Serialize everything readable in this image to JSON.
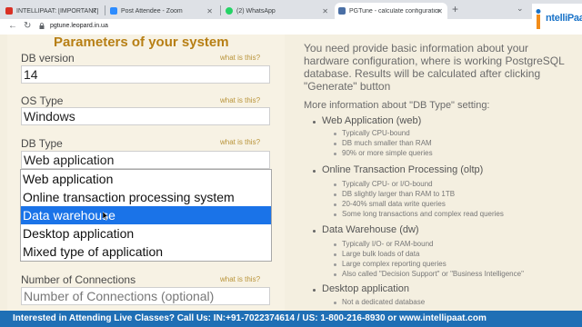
{
  "browser": {
    "tabs": [
      {
        "label": "INTELLIPAAT: [IMPORTANT] Post",
        "favicon_color": "#d93025"
      },
      {
        "label": "Post Attendee - Zoom",
        "favicon_color": "#2d8cff"
      },
      {
        "label": "(2) WhatsApp",
        "favicon_color": "#25d366"
      },
      {
        "label": "PGTune - calculate configuration",
        "favicon_color": "#4a6fa5"
      }
    ],
    "new_tab": "+",
    "url": "pgtune.leopard.in.ua"
  },
  "logo": {
    "text": "ntelliPaat"
  },
  "form": {
    "heading": "Parameters of your system",
    "hint": "what is this?",
    "db_version": {
      "label": "DB version",
      "value": "14"
    },
    "os_type": {
      "label": "OS Type",
      "value": "Windows"
    },
    "db_type": {
      "label": "DB Type",
      "value": "Web application",
      "options": [
        "Web application",
        "Online transaction processing system",
        "Data warehouse",
        "Desktop application",
        "Mixed type of application"
      ],
      "highlighted": "Data warehouse"
    },
    "connections": {
      "label": "Number of Connections",
      "placeholder": "Number of Connections (optional)"
    }
  },
  "info": {
    "intro": "You need provide basic information about your hardware configuration, where is working PostgreSQL database. Results will be calculated after clicking \"Generate\" button",
    "more": "More information about \"DB Type\" setting:",
    "categories": [
      {
        "name": "Web Application (web)",
        "bullets": [
          "Typically CPU-bound",
          "DB much smaller than RAM",
          "90% or more simple queries"
        ]
      },
      {
        "name": "Online Transaction Processing (oltp)",
        "bullets": [
          "Typically CPU- or I/O-bound",
          "DB slightly larger than RAM to 1TB",
          "20-40% small data write queries",
          "Some long transactions and complex read queries"
        ]
      },
      {
        "name": "Data Warehouse (dw)",
        "bullets": [
          "Typically I/O- or RAM-bound",
          "Large bulk loads of data",
          "Large complex reporting queries",
          "Also called \"Decision Support\" or \"Business Intelligence\""
        ]
      },
      {
        "name": "Desktop application",
        "bullets": [
          "Not a dedicated database"
        ]
      }
    ]
  },
  "banner": {
    "text": "Interested in Attending Live Classes? Call Us: IN:+91-7022374614 / US: 1-800-216-8930 or www.intellipaat.com"
  },
  "colors": {
    "heading": "#b77f14",
    "hint": "#b9943a",
    "selection": "#1a73e8",
    "banner": "#1f6fb5"
  }
}
